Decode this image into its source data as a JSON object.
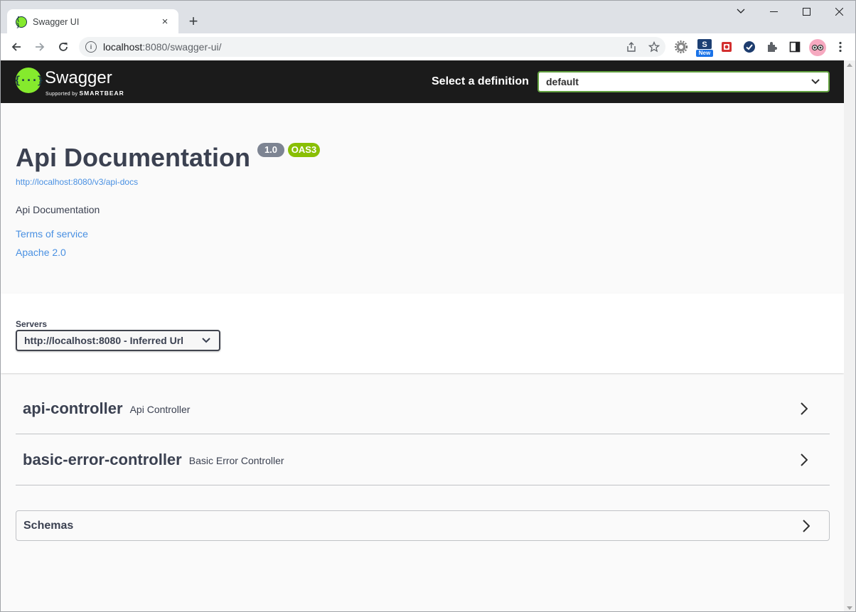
{
  "browser": {
    "tab_title": "Swagger UI",
    "tab_close": "×",
    "new_tab": "+",
    "url_host": "localhost",
    "url_rest": ":8080/swagger-ui/",
    "new_badge": "New"
  },
  "header": {
    "logo_brand": "Swagger",
    "logo_supported_by": "Supported by",
    "logo_company": "SMARTBEAR",
    "select_definition_label": "Select a definition",
    "definition_value": "default"
  },
  "info": {
    "title": "Api Documentation",
    "version": "1.0",
    "oas": "OAS3",
    "url": "http://localhost:8080/v3/api-docs",
    "description": "Api Documentation",
    "terms_link": "Terms of service",
    "license_link": "Apache 2.0"
  },
  "servers": {
    "label": "Servers",
    "selected": "http://localhost:8080 - Inferred Url"
  },
  "tags": [
    {
      "name": "api-controller",
      "description": "Api Controller"
    },
    {
      "name": "basic-error-controller",
      "description": "Basic Error Controller"
    }
  ],
  "schemas": {
    "title": "Schemas"
  },
  "colors": {
    "swagger_green": "#85ea2d",
    "topbar_bg": "#1b1b1b",
    "link_blue": "#4990e2",
    "version_badge": "#7d8492",
    "oas_badge": "#89bf04"
  },
  "icons": [
    "favicon-swagger-icon",
    "back-icon",
    "forward-icon",
    "reload-icon",
    "site-info-icon",
    "share-icon",
    "star-icon",
    "extension-icons",
    "chevron-down-icon",
    "chevron-right-icon"
  ]
}
